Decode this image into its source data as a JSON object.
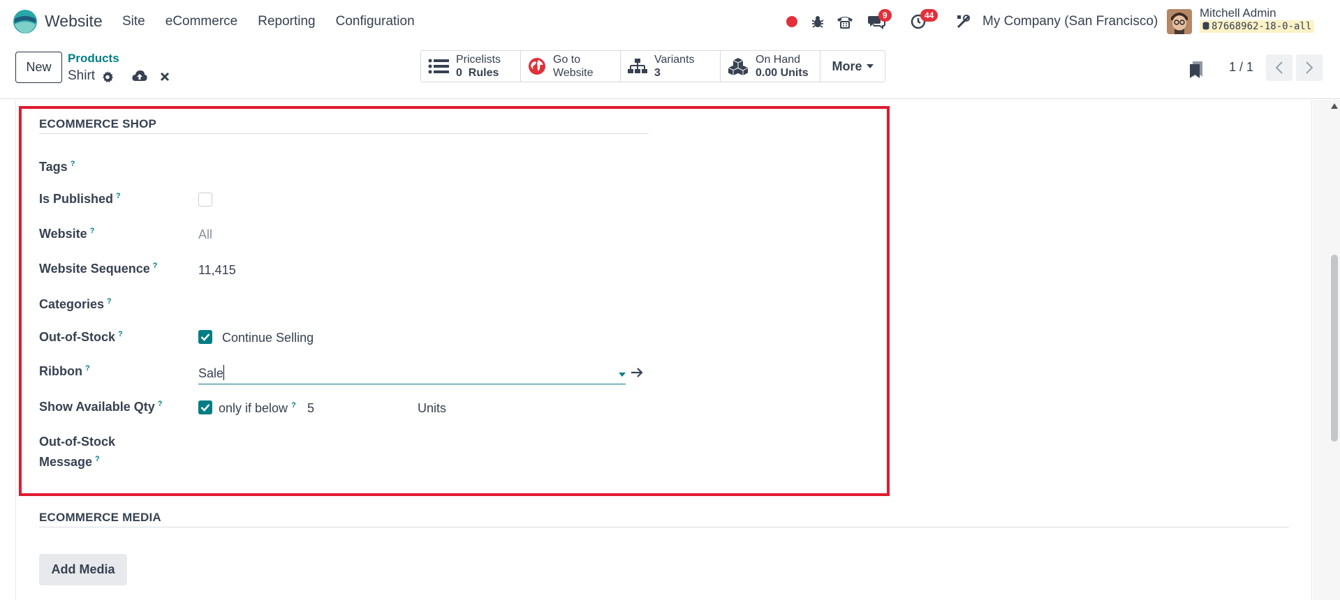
{
  "navbar": {
    "app_name": "Website",
    "menu": [
      "Site",
      "eCommerce",
      "Reporting",
      "Configuration"
    ],
    "messages_count": "9",
    "activities_count": "44",
    "company": "My Company (San Francisco)",
    "user_name": "Mitchell Admin",
    "db_name": "87668962-18-0-all"
  },
  "control_panel": {
    "new_label": "New",
    "breadcrumb_parent": "Products",
    "record_name": "Shirt",
    "smart_buttons": [
      {
        "line1": "Pricelists",
        "value": "0",
        "unit": "Rules",
        "icon": "list-icon"
      },
      {
        "line1": "Go to",
        "line2": "Website",
        "icon": "globe-icon"
      },
      {
        "line1": "Variants",
        "value": "3",
        "icon": "sitemap-icon"
      },
      {
        "line1": "On Hand",
        "value": "0.00",
        "unit": "Units",
        "icon": "cubes-icon"
      }
    ],
    "more_label": "More",
    "pager": "1 / 1"
  },
  "ecommerce_shop": {
    "title": "ECOMMERCE SHOP",
    "tags_label": "Tags",
    "is_published_label": "Is Published",
    "is_published": false,
    "website_label": "Website",
    "website_value": "All",
    "sequence_label": "Website Sequence",
    "sequence_value": "11,415",
    "categories_label": "Categories",
    "out_of_stock_label": "Out-of-Stock",
    "continue_selling_checked": true,
    "continue_selling_label": "Continue Selling",
    "ribbon_label": "Ribbon",
    "ribbon_value": "Sale",
    "show_qty_label": "Show Available Qty",
    "show_qty_checked": true,
    "only_if_below_label": "only if below",
    "threshold_value": "5",
    "threshold_unit": "Units",
    "oos_message_label_1": "Out-of-Stock",
    "oos_message_label_2": "Message"
  },
  "ecommerce_media": {
    "title": "ECOMMERCE MEDIA",
    "add_media_label": "Add Media"
  },
  "colors": {
    "accent": "#017e84",
    "highlight_border": "#e01b2f",
    "badge": "#e2303a"
  }
}
